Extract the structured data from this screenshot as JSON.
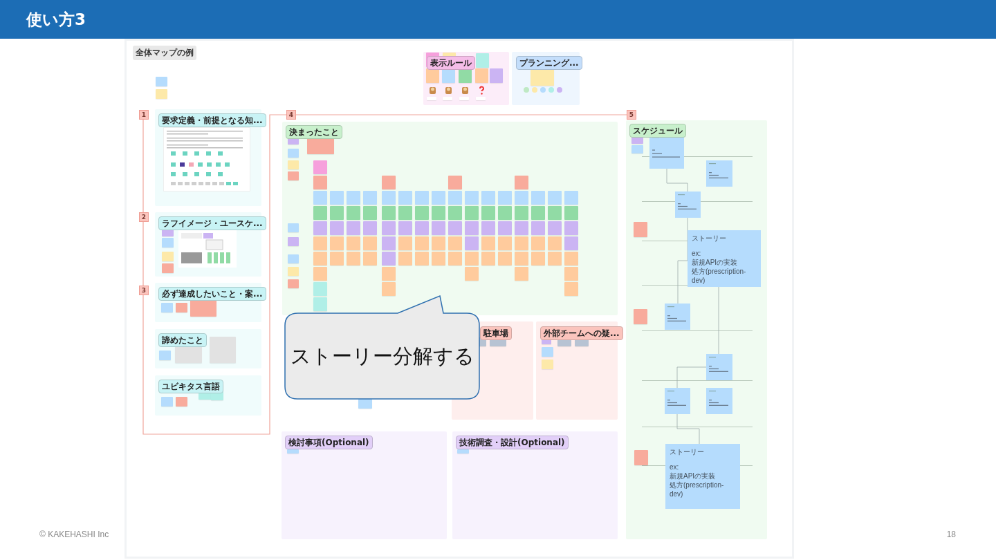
{
  "slide": {
    "title": "使い方3",
    "footer": "© KAKEHASHI Inc",
    "page_number": "18"
  },
  "board": {
    "label": "全体マップの例",
    "steps": [
      {
        "number": "1"
      },
      {
        "number": "2"
      },
      {
        "number": "3"
      },
      {
        "number": "4"
      },
      {
        "number": "5"
      }
    ],
    "frames": [
      {
        "title": "表示ルール",
        "color": "#f5bde8"
      },
      {
        "title": "プランニング...",
        "color": "#c4defb"
      },
      {
        "title": "要求定義・前提となる知...",
        "color": "#c8f3f5"
      },
      {
        "title": "決まったこと",
        "color": "#c8f0cc"
      },
      {
        "title": "スケジュール",
        "color": "#c8f0cc"
      },
      {
        "title": "ラフイメージ・ユースケ...",
        "color": "#c8f3f5"
      },
      {
        "title": "必ず達成したいこと・案...",
        "color": "#c8f3f5"
      },
      {
        "title": "諦めたこと",
        "color": "#c8f3f5"
      },
      {
        "title": "ユビキタス言語",
        "color": "#c8f3f5"
      },
      {
        "title": "駐車場",
        "color": "#fbc4bd"
      },
      {
        "title": "外部チームへの疑...",
        "color": "#fbc4bd"
      },
      {
        "title": "検討事項(Optional)",
        "color": "#e2cff8"
      },
      {
        "title": "技術調査・設計(Optional)",
        "color": "#e2cff8"
      }
    ],
    "story_cards": [
      {
        "heading": "ストーリー",
        "example_label": "ex:",
        "lines": [
          "新規APIの実装",
          "処方(prescription-dev)"
        ]
      },
      {
        "heading": "ストーリー",
        "example_label": "ex:",
        "lines": [
          "新規APIの実装",
          "処方(prescription-dev)"
        ]
      }
    ]
  },
  "callout": {
    "text": "ストーリー分解する"
  }
}
